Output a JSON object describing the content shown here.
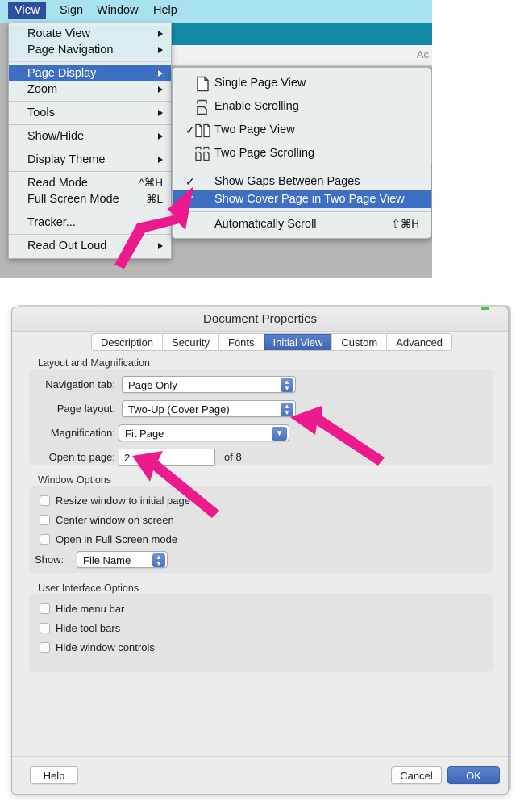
{
  "menubar": {
    "items": [
      {
        "label": "View",
        "active": true
      },
      {
        "label": "Sign",
        "active": false
      },
      {
        "label": "Window",
        "active": false
      },
      {
        "label": "Help",
        "active": false
      }
    ],
    "app_label": "Ac"
  },
  "view_menu": {
    "items": [
      {
        "label": "Rotate View",
        "submenu": true,
        "shortcut": "",
        "tinted": true,
        "selected": false
      },
      {
        "label": "Page Navigation",
        "submenu": true,
        "shortcut": "",
        "tinted": true,
        "selected": false
      },
      {
        "label": "Page Display",
        "submenu": true,
        "shortcut": "",
        "tinted": false,
        "selected": true
      },
      {
        "label": "Zoom",
        "submenu": true,
        "shortcut": "",
        "tinted": false,
        "selected": false
      },
      {
        "label": "Tools",
        "submenu": true,
        "shortcut": "",
        "tinted": false,
        "selected": false
      },
      {
        "label": "Show/Hide",
        "submenu": true,
        "shortcut": "",
        "tinted": false,
        "selected": false
      },
      {
        "label": "Display Theme",
        "submenu": true,
        "shortcut": "",
        "tinted": false,
        "selected": false
      },
      {
        "label": "Read Mode",
        "submenu": false,
        "shortcut": "^⌘H",
        "tinted": false,
        "selected": false
      },
      {
        "label": "Full Screen Mode",
        "submenu": false,
        "shortcut": "⌘L",
        "tinted": false,
        "selected": false
      },
      {
        "label": "Tracker...",
        "submenu": false,
        "shortcut": "",
        "tinted": false,
        "selected": false
      },
      {
        "label": "Read Out Loud",
        "submenu": true,
        "shortcut": "",
        "tinted": false,
        "selected": false
      }
    ]
  },
  "page_display_submenu": {
    "items": [
      {
        "label": "Single Page View",
        "icon": "single-page-icon",
        "checked": false,
        "shortcut": "",
        "selected": false
      },
      {
        "label": "Enable Scrolling",
        "icon": "enable-scrolling-icon",
        "checked": false,
        "shortcut": "",
        "selected": false
      },
      {
        "label": "Two Page View",
        "icon": "two-page-icon",
        "checked": true,
        "shortcut": "",
        "selected": false
      },
      {
        "label": "Two Page Scrolling",
        "icon": "two-page-scrolling-icon",
        "checked": false,
        "shortcut": "",
        "selected": false
      },
      {
        "label": "Show Gaps Between Pages",
        "icon": "",
        "checked": true,
        "shortcut": "",
        "selected": false
      },
      {
        "label": "Show Cover Page in Two Page View",
        "icon": "",
        "checked": true,
        "shortcut": "",
        "selected": true
      },
      {
        "label": "Automatically Scroll",
        "icon": "",
        "checked": false,
        "shortcut": "⇧⌘H",
        "selected": false
      }
    ]
  },
  "dialog": {
    "title": "Document Properties",
    "tabs": [
      {
        "label": "Description",
        "active": false
      },
      {
        "label": "Security",
        "active": false
      },
      {
        "label": "Fonts",
        "active": false
      },
      {
        "label": "Initial View",
        "active": true
      },
      {
        "label": "Custom",
        "active": false
      },
      {
        "label": "Advanced",
        "active": false
      }
    ],
    "layout_group": {
      "title": "Layout and Magnification",
      "navigation_tab": {
        "label": "Navigation tab:",
        "value": "Page Only",
        "control": "stepper-popup"
      },
      "page_layout": {
        "label": "Page layout:",
        "value": "Two-Up (Cover Page)",
        "control": "stepper-popup"
      },
      "magnification": {
        "label": "Magnification:",
        "value": "Fit Page",
        "control": "chevron-popup"
      },
      "open_to_page": {
        "label": "Open to page:",
        "value": "2",
        "suffix": "of 8"
      }
    },
    "window_group": {
      "title": "Window Options",
      "checkboxes": [
        {
          "label": "Resize window to initial page",
          "checked": false
        },
        {
          "label": "Center window on screen",
          "checked": false
        },
        {
          "label": "Open in Full Screen mode",
          "checked": false
        }
      ],
      "show": {
        "label": "Show:",
        "value": "File Name",
        "control": "stepper-popup"
      }
    },
    "ui_group": {
      "title": "User Interface Options",
      "checkboxes": [
        {
          "label": "Hide menu bar",
          "checked": false
        },
        {
          "label": "Hide tool bars",
          "checked": false
        },
        {
          "label": "Hide window controls",
          "checked": false
        }
      ]
    },
    "footer": {
      "help": "Help",
      "cancel": "Cancel",
      "ok": "OK"
    }
  },
  "annotations": {
    "accent_color": "#ec1a8d",
    "arrows": [
      {
        "name": "arrow-to-show-cover-page"
      },
      {
        "name": "arrow-to-page-layout-popup"
      },
      {
        "name": "arrow-to-open-to-page-field"
      }
    ]
  }
}
